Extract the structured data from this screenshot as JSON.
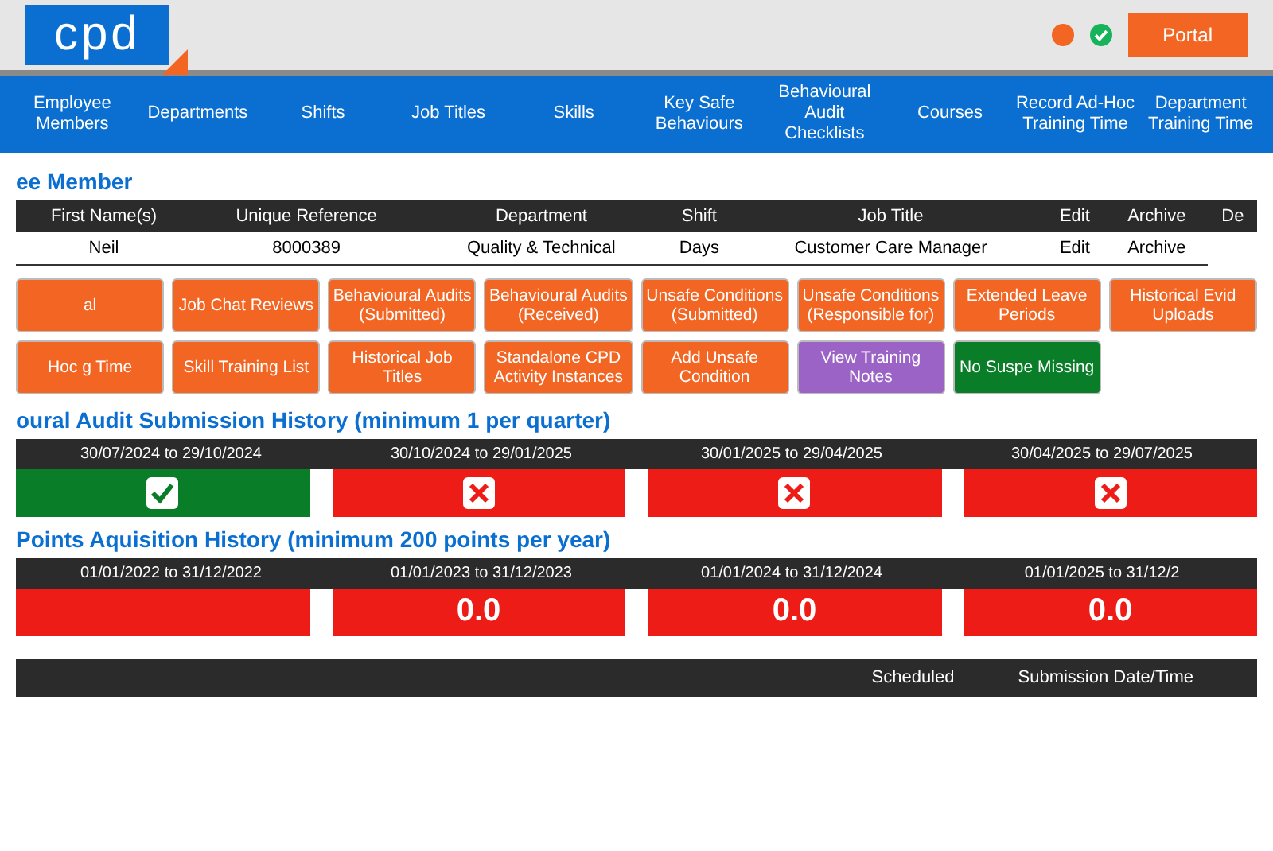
{
  "header": {
    "logo": "cpd",
    "portal_button": "Portal"
  },
  "nav": [
    "Employee Members",
    "Departments",
    "Shifts",
    "Job Titles",
    "Skills",
    "Key Safe Behaviours",
    "Behavioural Audit Checklists",
    "Courses",
    "Record Ad-Hoc Training Time",
    "Department Training Time"
  ],
  "member": {
    "heading": "ee Member",
    "columns": [
      "First Name(s)",
      "Unique Reference",
      "Department",
      "Shift",
      "Job Title",
      "Edit",
      "Archive",
      "De"
    ],
    "row": [
      "Neil",
      "8000389",
      "Quality & Technical",
      "Days",
      "Customer Care Manager",
      "Edit",
      "Archive"
    ]
  },
  "buttons": [
    {
      "label": "al",
      "color": "#f26522"
    },
    {
      "label": "Job Chat Reviews",
      "color": "#f26522"
    },
    {
      "label": "Behavioural Audits (Submitted)",
      "color": "#f26522"
    },
    {
      "label": "Behavioural Audits (Received)",
      "color": "#f26522"
    },
    {
      "label": "Unsafe Conditions (Submitted)",
      "color": "#f26522"
    },
    {
      "label": "Unsafe Conditions (Responsible for)",
      "color": "#f26522"
    },
    {
      "label": "Extended Leave Periods",
      "color": "#f26522"
    },
    {
      "label": "Historical Evid Uploads",
      "color": "#f26522"
    },
    {
      "label": "Hoc g Time",
      "color": "#f26522"
    },
    {
      "label": "Skill Training List",
      "color": "#f26522"
    },
    {
      "label": "Historical Job Titles",
      "color": "#f26522"
    },
    {
      "label": "Standalone CPD Activity Instances",
      "color": "#f26522"
    },
    {
      "label": "Add Unsafe Condition",
      "color": "#f26522"
    },
    {
      "label": "View Training Notes",
      "color": "#9b63c6"
    },
    {
      "label": "No Suspe Missing",
      "color": "#0a7d28"
    }
  ],
  "audit_history": {
    "heading": "oural Audit Submission History (minimum 1 per quarter)",
    "periods": [
      {
        "label": "30/07/2024 to 29/10/2024",
        "passed": true
      },
      {
        "label": "30/10/2024 to 29/01/2025",
        "passed": false
      },
      {
        "label": "30/01/2025 to 29/04/2025",
        "passed": false
      },
      {
        "label": "30/04/2025 to 29/07/2025",
        "passed": false
      }
    ]
  },
  "points_history": {
    "heading": "Points Aquisition History (minimum 200 points per year)",
    "periods": [
      {
        "label": "01/01/2022 to 31/12/2022",
        "passed": false
      },
      {
        "label": "01/01/2023 to 31/12/2023",
        "passed": false,
        "value": "0.0"
      },
      {
        "label": "01/01/2024 to 31/12/2024",
        "passed": false,
        "value": "0.0"
      },
      {
        "label": "01/01/2025 to 31/12/2",
        "passed": false,
        "value": "0.0"
      }
    ]
  },
  "submissions": {
    "columns": [
      "Scheduled",
      "Submission Date/Time"
    ]
  }
}
